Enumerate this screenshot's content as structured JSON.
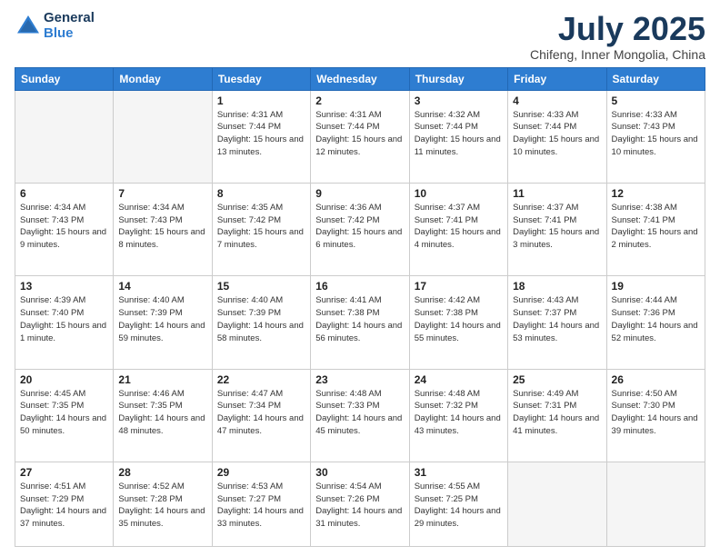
{
  "header": {
    "logo_line1": "General",
    "logo_line2": "Blue",
    "title": "July 2025",
    "subtitle": "Chifeng, Inner Mongolia, China"
  },
  "days_of_week": [
    "Sunday",
    "Monday",
    "Tuesday",
    "Wednesday",
    "Thursday",
    "Friday",
    "Saturday"
  ],
  "weeks": [
    [
      {
        "day": "",
        "info": ""
      },
      {
        "day": "",
        "info": ""
      },
      {
        "day": "1",
        "info": "Sunrise: 4:31 AM\nSunset: 7:44 PM\nDaylight: 15 hours and 13 minutes."
      },
      {
        "day": "2",
        "info": "Sunrise: 4:31 AM\nSunset: 7:44 PM\nDaylight: 15 hours and 12 minutes."
      },
      {
        "day": "3",
        "info": "Sunrise: 4:32 AM\nSunset: 7:44 PM\nDaylight: 15 hours and 11 minutes."
      },
      {
        "day": "4",
        "info": "Sunrise: 4:33 AM\nSunset: 7:44 PM\nDaylight: 15 hours and 10 minutes."
      },
      {
        "day": "5",
        "info": "Sunrise: 4:33 AM\nSunset: 7:43 PM\nDaylight: 15 hours and 10 minutes."
      }
    ],
    [
      {
        "day": "6",
        "info": "Sunrise: 4:34 AM\nSunset: 7:43 PM\nDaylight: 15 hours and 9 minutes."
      },
      {
        "day": "7",
        "info": "Sunrise: 4:34 AM\nSunset: 7:43 PM\nDaylight: 15 hours and 8 minutes."
      },
      {
        "day": "8",
        "info": "Sunrise: 4:35 AM\nSunset: 7:42 PM\nDaylight: 15 hours and 7 minutes."
      },
      {
        "day": "9",
        "info": "Sunrise: 4:36 AM\nSunset: 7:42 PM\nDaylight: 15 hours and 6 minutes."
      },
      {
        "day": "10",
        "info": "Sunrise: 4:37 AM\nSunset: 7:41 PM\nDaylight: 15 hours and 4 minutes."
      },
      {
        "day": "11",
        "info": "Sunrise: 4:37 AM\nSunset: 7:41 PM\nDaylight: 15 hours and 3 minutes."
      },
      {
        "day": "12",
        "info": "Sunrise: 4:38 AM\nSunset: 7:41 PM\nDaylight: 15 hours and 2 minutes."
      }
    ],
    [
      {
        "day": "13",
        "info": "Sunrise: 4:39 AM\nSunset: 7:40 PM\nDaylight: 15 hours and 1 minute."
      },
      {
        "day": "14",
        "info": "Sunrise: 4:40 AM\nSunset: 7:39 PM\nDaylight: 14 hours and 59 minutes."
      },
      {
        "day": "15",
        "info": "Sunrise: 4:40 AM\nSunset: 7:39 PM\nDaylight: 14 hours and 58 minutes."
      },
      {
        "day": "16",
        "info": "Sunrise: 4:41 AM\nSunset: 7:38 PM\nDaylight: 14 hours and 56 minutes."
      },
      {
        "day": "17",
        "info": "Sunrise: 4:42 AM\nSunset: 7:38 PM\nDaylight: 14 hours and 55 minutes."
      },
      {
        "day": "18",
        "info": "Sunrise: 4:43 AM\nSunset: 7:37 PM\nDaylight: 14 hours and 53 minutes."
      },
      {
        "day": "19",
        "info": "Sunrise: 4:44 AM\nSunset: 7:36 PM\nDaylight: 14 hours and 52 minutes."
      }
    ],
    [
      {
        "day": "20",
        "info": "Sunrise: 4:45 AM\nSunset: 7:35 PM\nDaylight: 14 hours and 50 minutes."
      },
      {
        "day": "21",
        "info": "Sunrise: 4:46 AM\nSunset: 7:35 PM\nDaylight: 14 hours and 48 minutes."
      },
      {
        "day": "22",
        "info": "Sunrise: 4:47 AM\nSunset: 7:34 PM\nDaylight: 14 hours and 47 minutes."
      },
      {
        "day": "23",
        "info": "Sunrise: 4:48 AM\nSunset: 7:33 PM\nDaylight: 14 hours and 45 minutes."
      },
      {
        "day": "24",
        "info": "Sunrise: 4:48 AM\nSunset: 7:32 PM\nDaylight: 14 hours and 43 minutes."
      },
      {
        "day": "25",
        "info": "Sunrise: 4:49 AM\nSunset: 7:31 PM\nDaylight: 14 hours and 41 minutes."
      },
      {
        "day": "26",
        "info": "Sunrise: 4:50 AM\nSunset: 7:30 PM\nDaylight: 14 hours and 39 minutes."
      }
    ],
    [
      {
        "day": "27",
        "info": "Sunrise: 4:51 AM\nSunset: 7:29 PM\nDaylight: 14 hours and 37 minutes."
      },
      {
        "day": "28",
        "info": "Sunrise: 4:52 AM\nSunset: 7:28 PM\nDaylight: 14 hours and 35 minutes."
      },
      {
        "day": "29",
        "info": "Sunrise: 4:53 AM\nSunset: 7:27 PM\nDaylight: 14 hours and 33 minutes."
      },
      {
        "day": "30",
        "info": "Sunrise: 4:54 AM\nSunset: 7:26 PM\nDaylight: 14 hours and 31 minutes."
      },
      {
        "day": "31",
        "info": "Sunrise: 4:55 AM\nSunset: 7:25 PM\nDaylight: 14 hours and 29 minutes."
      },
      {
        "day": "",
        "info": ""
      },
      {
        "day": "",
        "info": ""
      }
    ]
  ]
}
